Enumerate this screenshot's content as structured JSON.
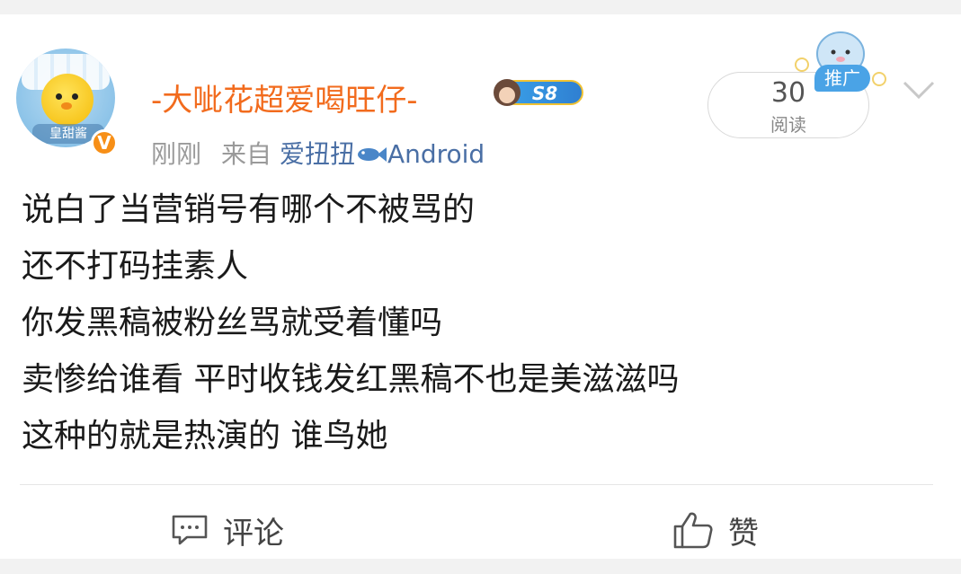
{
  "post": {
    "username": "-大呲花超爱喝旺仔-",
    "level_badge": "S8",
    "avatar_tag": "皇甜酱",
    "verified_mark": "V",
    "time": "刚刚",
    "from_label": "来自",
    "source": "爱扭扭",
    "device": "Android",
    "read_count": "30",
    "read_label": "阅读",
    "promo_label": "推广",
    "lines": [
      "说白了当营销号有哪个不被骂的",
      "还不打码挂素人",
      "你发黑稿被粉丝骂就受着懂吗",
      "卖惨给谁看 平时收钱发红黑稿不也是美滋滋吗",
      "这种的就是热演的 谁鸟她"
    ]
  },
  "actions": {
    "comment_label": "评论",
    "like_label": "赞"
  },
  "colors": {
    "username": "#f26b1d",
    "source_link": "#4a6fa5",
    "verified_badge": "#f78f17",
    "promo_tag": "#4aa3e6"
  },
  "icons": [
    "avatar",
    "verified-badge-icon",
    "level-badge-icon",
    "fish-icon",
    "promo-mascot-icon",
    "chevron-down-icon",
    "comment-icon",
    "thumbs-up-icon"
  ]
}
